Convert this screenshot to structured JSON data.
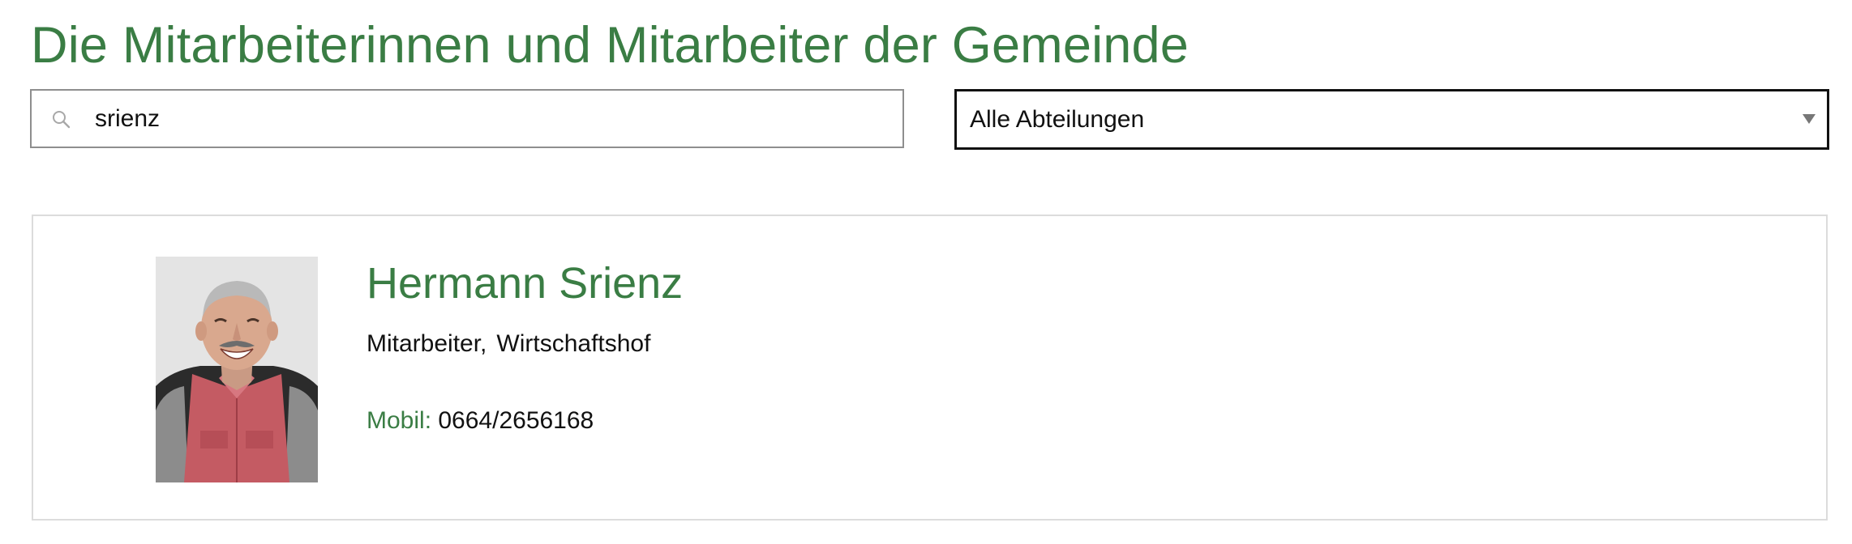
{
  "page": {
    "title": "Die Mitarbeiterinnen und Mitarbeiter der Gemeinde"
  },
  "search": {
    "value": "srienz",
    "icon": "search-icon"
  },
  "department_filter": {
    "selected": "Alle Abteilungen",
    "icon": "chevron-down-icon"
  },
  "employees": [
    {
      "name": "Hermann Srienz",
      "role": "Mitarbeiter,",
      "department": "Wirtschaftshof",
      "mobile_label": "Mobil:",
      "mobile_number": "0664/2656168"
    }
  ],
  "colors": {
    "accent": "#3a7d44",
    "text": "#111111",
    "card_border": "#dcdcdc",
    "input_border": "#8e8e8e"
  }
}
